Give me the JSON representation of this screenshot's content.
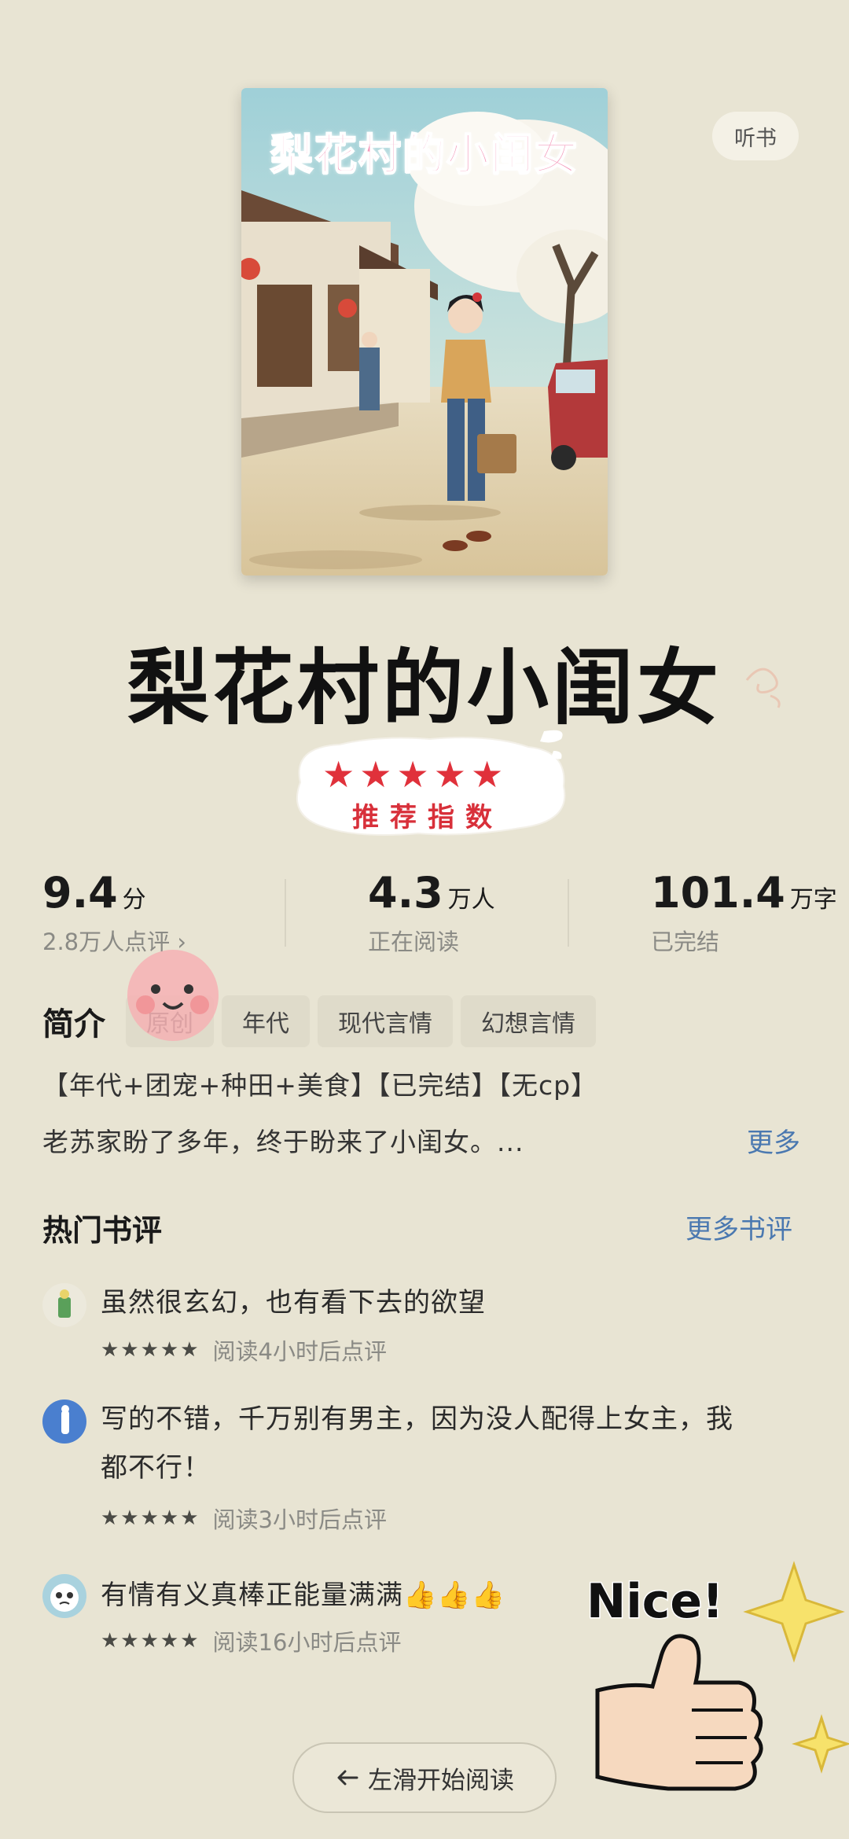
{
  "header": {
    "listen_label": "听书"
  },
  "book": {
    "cover_title": "梨花村的小闺女",
    "title": "梨花村的小闺女"
  },
  "recommend_sticker": {
    "label": "推荐指数",
    "stars": "★★★★★"
  },
  "stats": {
    "score": {
      "value": "9.4",
      "unit": "分",
      "sub": "2.8万人点评 ›"
    },
    "readers": {
      "value": "4.3",
      "unit": "万人",
      "sub": "正在阅读"
    },
    "words": {
      "value": "101.4",
      "unit": "万字",
      "sub": "已完结"
    }
  },
  "intro": {
    "label": "简介",
    "tags": [
      "原创",
      "年代",
      "现代言情",
      "幻想言情"
    ],
    "line1": "【年代+团宠+种田+美食】【已完结】【无cp】",
    "line2": "老苏家盼了多年，终于盼来了小闺女。...",
    "more_label": "更多"
  },
  "reviews_section": {
    "title": "热门书评",
    "more_label": "更多书评",
    "items": [
      {
        "text": "虽然很玄幻，也有看下去的欲望",
        "stars": "★★★★★",
        "meta": "阅读4小时后点评"
      },
      {
        "text_line1": "写的不错，千万别有男主，因为没人配得上女主，我",
        "text_line2": "都不行！",
        "stars": "★★★★★",
        "meta": "阅读3小时后点评"
      },
      {
        "text": "有情有义真棒正能量满满👍👍👍",
        "stars": "★★★★★",
        "meta": "阅读16小时后点评"
      }
    ]
  },
  "start_button": {
    "label": "左滑开始阅读",
    "icon": "arrow-left-icon"
  },
  "nice_sticker": {
    "label": "Nice!"
  },
  "colors": {
    "background": "#e8e4d3",
    "link": "#4a78b0",
    "star_red": "#e0313b"
  }
}
